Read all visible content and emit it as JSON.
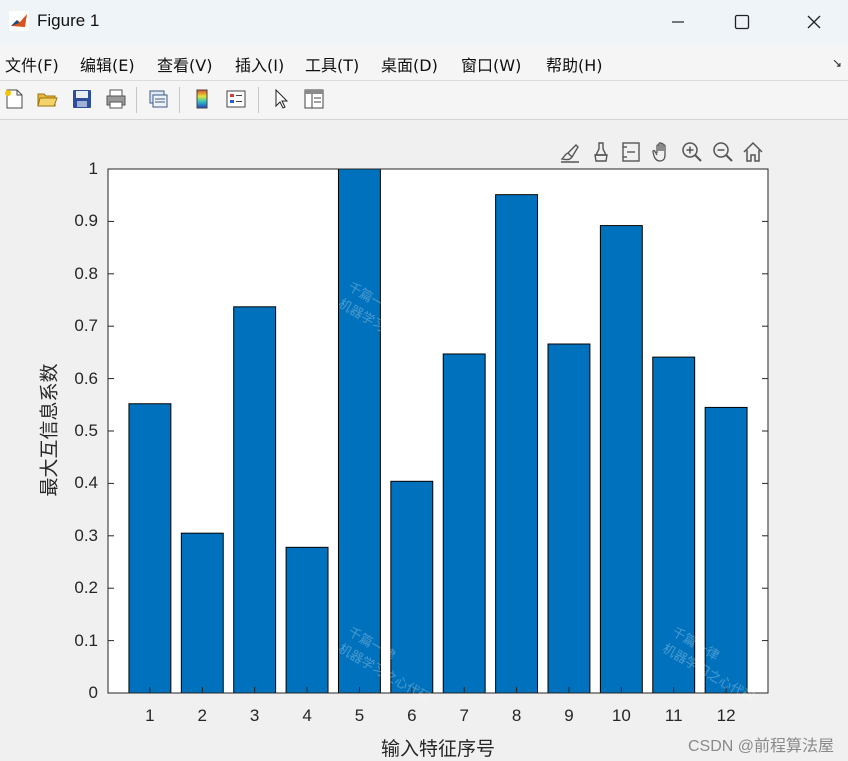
{
  "window": {
    "title": "Figure 1"
  },
  "menubar": {
    "items": [
      "文件(F)",
      "编辑(E)",
      "查看(V)",
      "插入(I)",
      "工具(T)",
      "桌面(D)",
      "窗口(W)",
      "帮助(H)"
    ]
  },
  "toolbar": {
    "icons": [
      "new-figure-icon",
      "open-file-icon",
      "save-icon",
      "print-icon",
      "link-plot-icon",
      "colorbar-icon",
      "legend-icon",
      "pointer-icon",
      "property-inspector-icon"
    ]
  },
  "axes_toolbar": {
    "icons": [
      "brush-icon",
      "data-cursor-icon",
      "restore-view-icon",
      "pan-icon",
      "zoom-in-icon",
      "zoom-out-icon",
      "home-icon"
    ]
  },
  "chart_data": {
    "type": "bar",
    "categories": [
      "1",
      "2",
      "3",
      "4",
      "5",
      "6",
      "7",
      "8",
      "9",
      "10",
      "11",
      "12"
    ],
    "values": [
      0.552,
      0.305,
      0.737,
      0.278,
      1.0,
      0.404,
      0.647,
      0.951,
      0.666,
      0.892,
      0.641,
      0.545
    ],
    "title": "",
    "xlabel": "输入特征序号",
    "ylabel": "最大互信息系数",
    "ylim": [
      0,
      1
    ],
    "yticks": [
      "0",
      "0.1",
      "0.2",
      "0.3",
      "0.4",
      "0.5",
      "0.6",
      "0.7",
      "0.8",
      "0.9",
      "1"
    ],
    "bar_color": "#0072bd",
    "grid": false
  },
  "watermarks": [
    {
      "line1": "千篇一律",
      "line2": "机器学习之心代码"
    },
    {
      "line1": "千篇一律",
      "line2": "机器学习之心代码"
    },
    {
      "line1": "千篇一律",
      "line2": "机器学习之心代码"
    },
    {
      "line1": "千篇一律",
      "line2": "机器学习之心代码"
    }
  ],
  "credit": "CSDN @前程算法屋"
}
